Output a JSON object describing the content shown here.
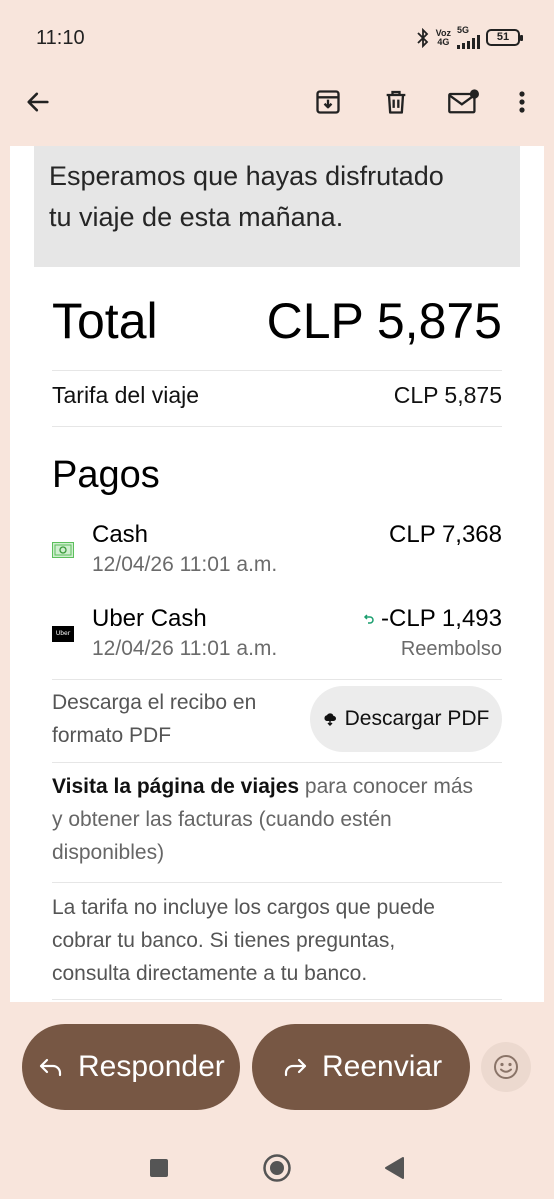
{
  "status_bar": {
    "time": "11:10",
    "net_top": "Voz",
    "net_bottom": "4G",
    "net2": "5G",
    "battery": "51"
  },
  "toolbar": {
    "icons": [
      "back-arrow-icon",
      "archive-icon",
      "delete-icon",
      "mark-unread-icon",
      "more-vert-icon"
    ]
  },
  "email": {
    "banner_line1": "Esperamos que hayas disfrutado",
    "banner_line2": "tu viaje de esta mañana.",
    "total_label": "Total",
    "total_value": "CLP 5,875",
    "fare_label": "Tarifa del viaje",
    "fare_value": "CLP 5,875",
    "payments_title": "Pagos",
    "payments": [
      {
        "name": "Cash",
        "date": "12/04/26 11:01 a.m.",
        "amount": "CLP 7,368",
        "sub": "",
        "icon": "cash-icon"
      },
      {
        "name": "Uber Cash",
        "date": "12/04/26 11:01 a.m.",
        "amount": "-CLP 1,493",
        "sub": "Reembolso",
        "icon": "uber-icon"
      }
    ],
    "uber_logo_text": "Uber",
    "pdf_text_line1": "Descarga el recibo en",
    "pdf_text_line2": "formato PDF",
    "pdf_button": "Descargar PDF",
    "visit_link": "Visita la página de viajes",
    "visit_rest_1": " para conocer más",
    "visit_rest_2": "y obtener las facturas (cuando estén",
    "visit_rest_3": "disponibles)",
    "note_line1": "La tarifa no incluye los cargos que puede",
    "note_line2": "cobrar tu banco. Si tienes preguntas,",
    "note_line3": "consulta directamente a tu banco."
  },
  "actions": {
    "reply": "Responder",
    "forward": "Reenviar"
  },
  "colors": {
    "background": "#f8e5dc",
    "action_button": "#775744",
    "banner": "#e6e6e6",
    "refund_arrow": "#1a9e6e",
    "cash_icon": "#5cbf5c"
  }
}
